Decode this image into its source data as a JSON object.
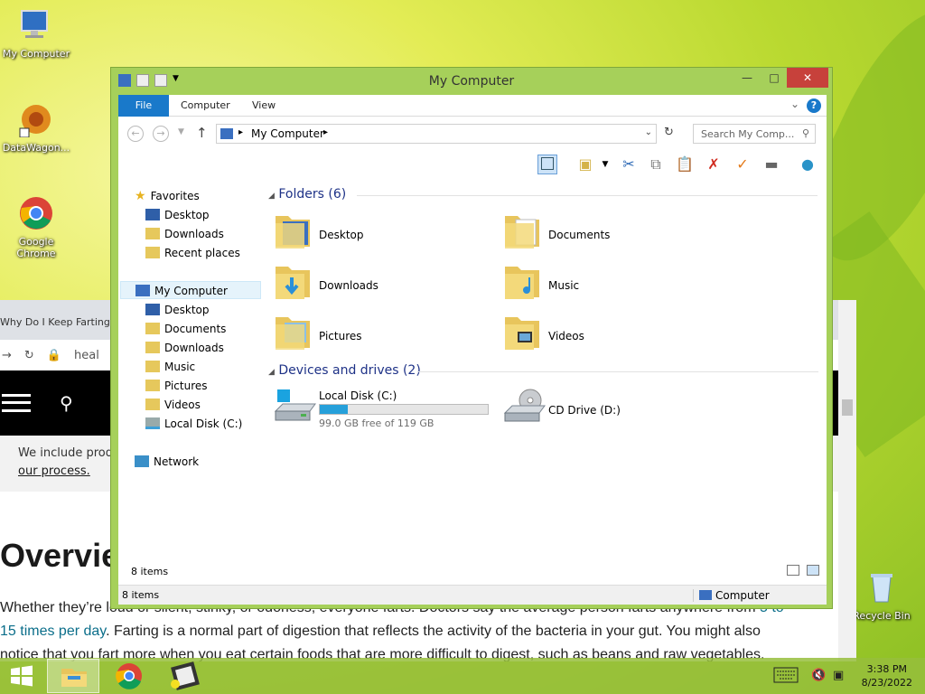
{
  "desktop": {
    "icons": [
      {
        "label": "My Computer"
      },
      {
        "label": "DataWagon..."
      },
      {
        "label": "Google Chrome"
      },
      {
        "label": "Recycle Bin"
      }
    ]
  },
  "browser": {
    "tab_title": "Why Do I Keep Farting:",
    "url": "heal",
    "consent_text": "We include prod",
    "consent_link": "our process.",
    "heading": "Overvie",
    "paragraph": {
      "p1": "Whether they’re loud or silent, stinky, or odorless, everyone farts. Doctors say the average person farts anywhere from ",
      "link": "5 to 15 times per day",
      "p2": ". Farting is a normal part of digestion that reflects the activity of the bacteria in your gut. You might also notice that you fart more when you eat certain foods that are more difficult to digest, such as beans and raw vegetables."
    }
  },
  "window": {
    "title": "My Computer",
    "ribbon_tabs": [
      "File",
      "Computer",
      "View"
    ],
    "address": "My Computer",
    "search_placeholder": "Search My Comp...",
    "nav": {
      "favorites": "Favorites",
      "fav_items": [
        "Desktop",
        "Downloads",
        "Recent places"
      ],
      "computer": "My Computer",
      "computer_items": [
        "Desktop",
        "Documents",
        "Downloads",
        "Music",
        "Pictures",
        "Videos",
        "Local Disk (C:)"
      ],
      "network": "Network"
    },
    "folders_header": "Folders (6)",
    "folders": [
      "Desktop",
      "Documents",
      "Downloads",
      "Music",
      "Pictures",
      "Videos"
    ],
    "drives_header": "Devices and drives (2)",
    "drives": [
      {
        "name": "Local Disk (C:)",
        "free": "99.0 GB free of 119 GB",
        "used_fraction": 0.168
      },
      {
        "name": "CD Drive (D:)"
      }
    ],
    "status_items": "8 items",
    "status_items2": "8 items",
    "status_computer": "Computer"
  },
  "taskbar": {
    "time": "3:38 PM",
    "date": "8/23/2022"
  },
  "colors": {
    "window_frame": "#a6d05a",
    "file_tab": "#1979ca",
    "close_button": "#c7413b",
    "drive_bar": "#26a0da",
    "group_header": "#1e3287"
  }
}
